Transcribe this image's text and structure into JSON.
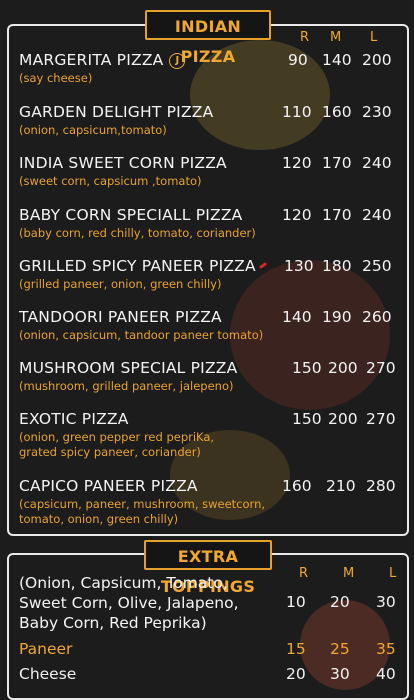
{
  "menu": {
    "title": "INDIAN PIZZA",
    "sizes": [
      "R",
      "M",
      "L"
    ],
    "items": [
      {
        "name": "MARGERITA PIZZA",
        "desc1": "(say cheese)",
        "desc2": "",
        "prices": [
          "90",
          "140",
          "200"
        ],
        "badge": "J"
      },
      {
        "name": "GARDEN DELIGHT PIZZA",
        "desc1": "(onion, capsicum,tomato)",
        "desc2": "",
        "prices": [
          "110",
          "160",
          "230"
        ]
      },
      {
        "name": "INDIA SWEET CORN PIZZA",
        "desc1": "(sweet corn, capsicum ,tomato)",
        "desc2": "",
        "prices": [
          "120",
          "170",
          "240"
        ]
      },
      {
        "name": "BABY CORN SPECIALL PIZZA",
        "desc1": "(baby corn, red chilly, tomato, coriander)",
        "desc2": "",
        "prices": [
          "120",
          "170",
          "240"
        ]
      },
      {
        "name": "GRILLED SPICY PANEER PIZZA",
        "desc1": "(grilled paneer, onion, green chilly)",
        "desc2": "",
        "prices": [
          "130",
          "180",
          "250"
        ]
      },
      {
        "name": "TANDOORI PANEER PIZZA",
        "desc1": "(onion, capsicum, tandoor paneer tomato)",
        "desc2": "",
        "prices": [
          "140",
          "190",
          "260"
        ]
      },
      {
        "name": "MUSHROOM SPECIAL PIZZA",
        "desc1": "(mushroom, grilled paneer, jalepeno)",
        "desc2": "",
        "prices": [
          "150",
          "200",
          "270"
        ]
      },
      {
        "name": "EXOTIC PIZZA",
        "desc1": "(onion, green pepper red pepriKa,",
        "desc2": "grated spicy paneer, coriander)",
        "prices": [
          "150",
          "200",
          "270"
        ]
      },
      {
        "name": "CAPICO PANEER PIZZA",
        "desc1": "(capsicum, paneer, mushroom, sweetcorn,",
        "desc2": "tomato, onion, green chilly)",
        "prices": [
          "160",
          "210",
          "280"
        ]
      }
    ]
  },
  "extras": {
    "title": "EXTRA TOPPINGS",
    "sizes": [
      "R",
      "M",
      "L"
    ],
    "veg_line1": "(Onion, Capsicum, Tomato,",
    "veg_line2": "Sweet Corn, Olive, Jalapeno,",
    "veg_line3": "Baby Corn, Red Peprika)",
    "veg_prices": [
      "10",
      "20",
      "30"
    ],
    "rows": [
      {
        "label": "Paneer",
        "prices": [
          "15",
          "25",
          "35"
        ]
      },
      {
        "label": "Cheese",
        "prices": [
          "20",
          "30",
          "40"
        ]
      }
    ]
  },
  "colors": {
    "accent": "#f0a833",
    "text": "#f4f4f4",
    "background": "#1c1c1c"
  }
}
